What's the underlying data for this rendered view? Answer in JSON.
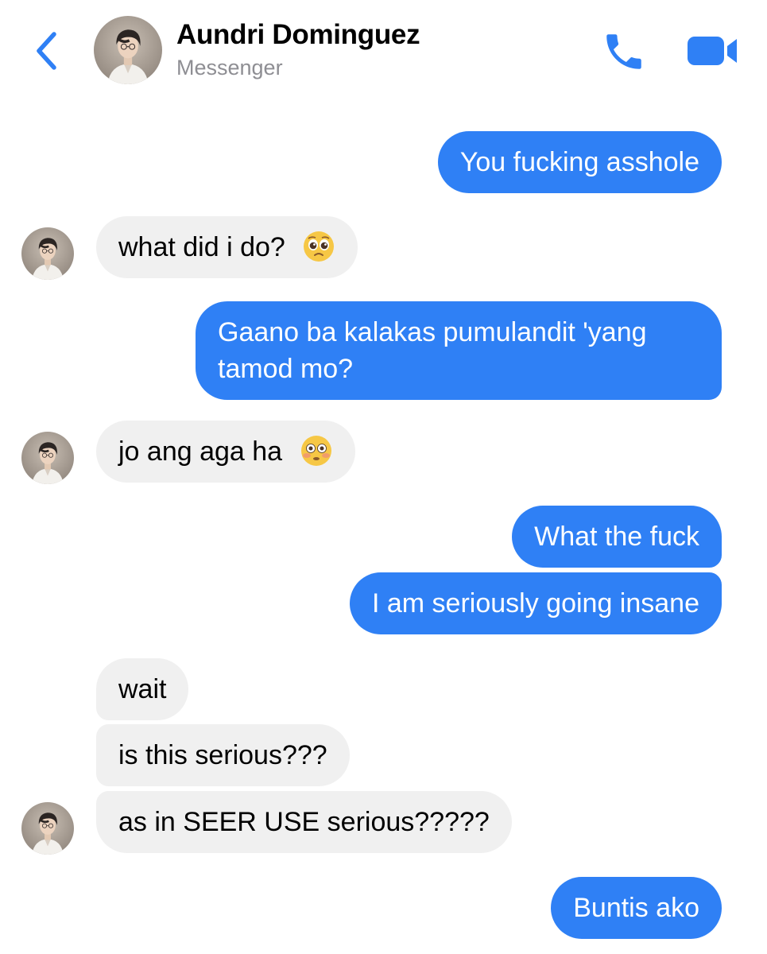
{
  "header": {
    "contact_name": "Aundri Dominguez",
    "subtitle": "Messenger",
    "back_icon": "chevron-left-icon",
    "call_icon": "phone-icon",
    "video_icon": "video-camera-icon"
  },
  "colors": {
    "accent": "#2f80f5",
    "outgoing_bubble": "#2f80f5",
    "incoming_bubble": "#f0f0f0",
    "subtitle_gray": "#8e8e93"
  },
  "messages": [
    {
      "direction": "outgoing",
      "text": "You fucking asshole"
    },
    {
      "direction": "incoming",
      "text": "what did i do?",
      "emoji": "pleading-face"
    },
    {
      "direction": "outgoing",
      "line1": "Gaano ba kalakas pumulandit 'yang",
      "line2": "tamod mo?"
    },
    {
      "direction": "incoming",
      "text": "jo ang aga ha",
      "emoji": "flushed-face"
    },
    {
      "direction": "outgoing",
      "text": "What the fuck"
    },
    {
      "direction": "outgoing",
      "text": "I am seriously going insane"
    },
    {
      "direction": "incoming",
      "text": "wait"
    },
    {
      "direction": "incoming",
      "text": "is this serious???"
    },
    {
      "direction": "incoming",
      "text": "as in SEER USE serious?????"
    },
    {
      "direction": "outgoing",
      "text": "Buntis ako"
    }
  ]
}
